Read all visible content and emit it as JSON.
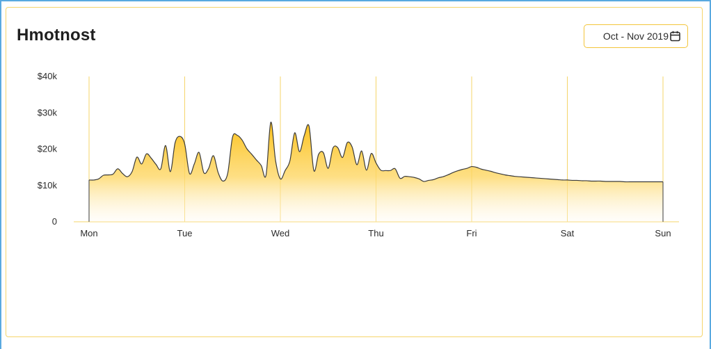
{
  "header": {
    "title": "Hmotnost",
    "date_range": "Oct - Nov 2019",
    "calendar_icon": "calendar-icon"
  },
  "colors": {
    "accent": "#f5c518",
    "line": "#3a3a3a",
    "grid": "#f5d56a",
    "frame": "#5aa9e0"
  },
  "chart_data": {
    "type": "area",
    "title": "",
    "xlabel": "",
    "ylabel": "",
    "x_ticks": [
      "Mon",
      "Tue",
      "Wed",
      "Thu",
      "Fri",
      "Sat",
      "Sun"
    ],
    "y_ticks": [
      "0",
      "$10k",
      "$20k",
      "$30k",
      "$40k"
    ],
    "y_tick_values": [
      0,
      10000,
      20000,
      30000,
      40000
    ],
    "ylim": [
      0,
      40000
    ],
    "grid": "vertical",
    "legend": "none",
    "series": [
      {
        "x": [
          0,
          0.05,
          0.1,
          0.15,
          0.2,
          0.25,
          0.3,
          0.35,
          0.4,
          0.45,
          0.5,
          0.55,
          0.6,
          0.65,
          0.7,
          0.75,
          0.8,
          0.85,
          0.9,
          0.95,
          1,
          1.05,
          1.1,
          1.15,
          1.2,
          1.25,
          1.3,
          1.35,
          1.4,
          1.45,
          1.5,
          1.55,
          1.6,
          1.65,
          1.7,
          1.75,
          1.8,
          1.85,
          1.9,
          1.95,
          2,
          2.05,
          2.1,
          2.15,
          2.2,
          2.25,
          2.3,
          2.35,
          2.4,
          2.45,
          2.5,
          2.55,
          2.6,
          2.65,
          2.7,
          2.75,
          2.8,
          2.85,
          2.9,
          2.95,
          3,
          3.05,
          3.1,
          3.15,
          3.2,
          3.25,
          3.3,
          3.35,
          3.4,
          3.45,
          3.5,
          3.55,
          3.6,
          3.65,
          3.7,
          3.75,
          3.8,
          3.85,
          3.9,
          3.95,
          4,
          4.05,
          4.1,
          4.15,
          4.2,
          4.25,
          4.3,
          4.35,
          4.4,
          4.45,
          4.5,
          4.55,
          4.6,
          4.65,
          4.7,
          4.75,
          4.8,
          4.85,
          4.9,
          4.95,
          5,
          5.05,
          5.1,
          5.15,
          5.2,
          5.25,
          5.3,
          5.35,
          5.4,
          5.45,
          5.5,
          5.55,
          5.6,
          5.65,
          5.7,
          5.75,
          5.8,
          5.85,
          5.9,
          5.95,
          6
        ],
        "values": [
          11500,
          11500,
          11800,
          12800,
          12900,
          13100,
          14600,
          13300,
          12400,
          13800,
          17800,
          15900,
          18700,
          17500,
          15800,
          14600,
          21000,
          13800,
          21800,
          23500,
          21400,
          13300,
          15900,
          19100,
          13500,
          14700,
          18200,
          13500,
          11200,
          13400,
          23300,
          23800,
          22500,
          20100,
          18600,
          17000,
          15500,
          12800,
          27400,
          16800,
          11800,
          14100,
          16800,
          24500,
          19300,
          23800,
          26300,
          14100,
          18600,
          19000,
          14700,
          20300,
          20400,
          17700,
          21800,
          20600,
          15700,
          19500,
          14200,
          18800,
          16200,
          14200,
          14100,
          14100,
          14600,
          12000,
          12500,
          12400,
          12200,
          11800,
          11100,
          11400,
          11600,
          12100,
          12400,
          12900,
          13500,
          14000,
          14400,
          14700,
          15200,
          15000,
          14500,
          14200,
          13900,
          13500,
          13200,
          12900,
          12700,
          12500,
          12400,
          12300,
          12200,
          12100,
          12000,
          11900,
          11800,
          11700,
          11600,
          11500,
          11500,
          11400,
          11400,
          11300,
          11300,
          11200,
          11200,
          11200,
          11100,
          11100,
          11100,
          11100,
          11000,
          11000,
          11000,
          11000,
          11000,
          11000,
          11000,
          11000,
          11000
        ]
      }
    ]
  }
}
